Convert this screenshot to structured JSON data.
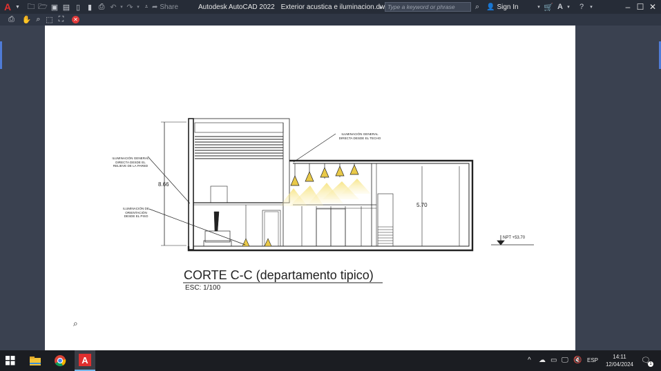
{
  "app": {
    "title": "Autodesk AutoCAD 2022",
    "file_name": "Exterior acustica e iluminacion.dwg",
    "share_label": "Share",
    "search_placeholder": "Type a keyword or phrase",
    "sign_in_label": "Sign In"
  },
  "drawing": {
    "section_title": "CORTE C-C (departamento tipico)",
    "scale_label": "ESC: 1/100",
    "label_lighting_wall": "ILUMINACIÓN GENERAL DIRECTA DESDE EL RELIEVE DE LA PARED",
    "label_lighting_wall_lines": [
      "ILUMINACIÓN GENERAL",
      "DIRECTA DESDE EL",
      "RELIEVE DE LA PARED"
    ],
    "label_lighting_ceiling_lines": [
      "ILUMINACIÓN GENERAL",
      "DIRECTA DESDE EL TECHO"
    ],
    "label_orientation_lines": [
      "ILUMINACIÓN DE",
      "ORIENTACIÓN",
      "DESDE EL PISO"
    ],
    "dim_total_height": "8.66",
    "dim_right_height": "5.70",
    "level_label": "NPT +53.70"
  },
  "taskbar": {
    "language": "ESP",
    "time": "14:11",
    "date": "12/04/2024",
    "notification_count": "1"
  }
}
